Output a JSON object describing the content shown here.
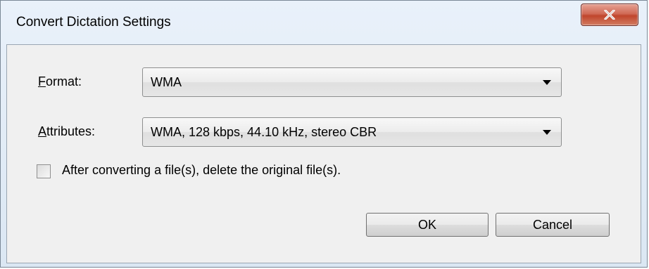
{
  "window": {
    "title": "Convert Dictation Settings",
    "close_icon": "close-icon"
  },
  "format": {
    "label_accel": "F",
    "label_rest": "ormat:",
    "value": "WMA"
  },
  "attributes": {
    "label_accel": "A",
    "label_rest": "ttributes:",
    "value": "WMA, 128 kbps, 44.10 kHz, stereo CBR"
  },
  "delete_original": {
    "label": "After converting a file(s), delete the original file(s).",
    "checked": false
  },
  "buttons": {
    "ok": "OK",
    "cancel": "Cancel"
  },
  "colors": {
    "close_button": "#c9543c",
    "frame": "#dbe7f3",
    "client": "#f0f0f0"
  }
}
